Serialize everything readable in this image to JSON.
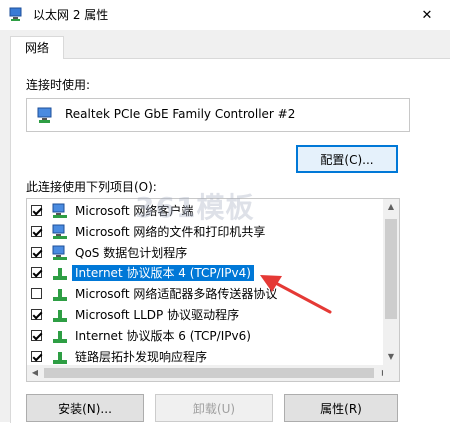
{
  "window": {
    "title": "以太网 2 属性",
    "close_glyph": "✕"
  },
  "tabs": [
    {
      "label": "网络"
    }
  ],
  "connect_using": {
    "label": "连接时使用:",
    "device_name": "Realtek PCIe GbE Family Controller #2",
    "configure_button": "配置(C)..."
  },
  "items_section": {
    "label": "此连接使用下列项目(O):",
    "items": [
      {
        "label": "Microsoft 网络客户端",
        "checked": true,
        "icon": "network-client-icon",
        "selected": false
      },
      {
        "label": "Microsoft 网络的文件和打印机共享",
        "checked": true,
        "icon": "network-client-icon",
        "selected": false
      },
      {
        "label": "QoS 数据包计划程序",
        "checked": true,
        "icon": "network-client-icon",
        "selected": false
      },
      {
        "label": "Internet 协议版本 4 (TCP/IPv4)",
        "checked": true,
        "icon": "protocol-icon",
        "selected": true
      },
      {
        "label": "Microsoft 网络适配器多路传送器协议",
        "checked": false,
        "icon": "protocol-icon",
        "selected": false
      },
      {
        "label": "Microsoft LLDP 协议驱动程序",
        "checked": true,
        "icon": "protocol-icon",
        "selected": false
      },
      {
        "label": "Internet 协议版本 6 (TCP/IPv6)",
        "checked": true,
        "icon": "protocol-icon",
        "selected": false
      },
      {
        "label": "链路层拓扑发现响应程序",
        "checked": true,
        "icon": "protocol-icon",
        "selected": false
      }
    ]
  },
  "buttons": {
    "install": "安装(N)...",
    "uninstall": "卸载(U)",
    "properties": "属性(R)"
  },
  "watermark": "361模板",
  "colors": {
    "selection": "#0078d7",
    "annotation_arrow": "#e53935"
  }
}
